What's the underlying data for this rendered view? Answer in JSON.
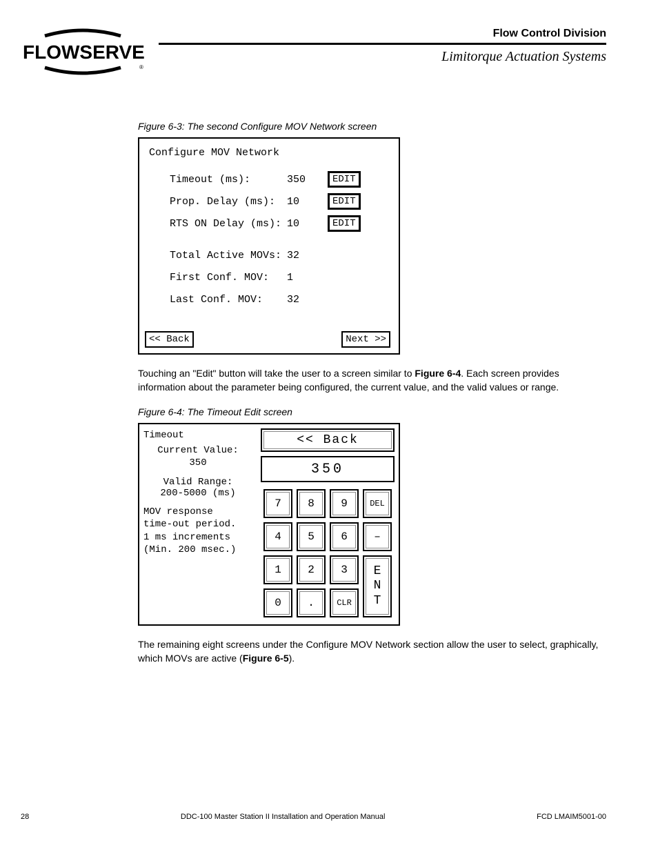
{
  "header": {
    "logo_text": "FLOWSERVE",
    "division": "Flow Control Division",
    "subtitle": "Limitorque Actuation Systems"
  },
  "fig63": {
    "caption": "Figure 6-3: The second Configure MOV Network screen",
    "title": "Configure MOV Network",
    "rows": [
      {
        "label": "Timeout (ms):",
        "value": "350",
        "edit": true
      },
      {
        "label": "Prop. Delay (ms):",
        "value": "10",
        "edit": true
      },
      {
        "label": "RTS ON Delay (ms):",
        "value": "10",
        "edit": true
      },
      {
        "label": "Total Active MOVs:",
        "value": "32",
        "edit": false
      },
      {
        "label": "First Conf. MOV:",
        "value": "1",
        "edit": false
      },
      {
        "label": "Last Conf. MOV:",
        "value": "32",
        "edit": false
      }
    ],
    "edit_label": "EDIT",
    "back": "<< Back",
    "next": "Next >>"
  },
  "para1a": "Touching an \"Edit\" button will take the user to a screen similar to ",
  "para1b": "Figure 6-4",
  "para1c": ". Each screen provides information about the parameter being configured, the current value, and the valid values or range.",
  "fig64": {
    "caption": "Figure 6-4: The Timeout Edit screen",
    "title": "Timeout",
    "cv_label": "Current Value:",
    "cv_value": "350",
    "range_label": "Valid Range:",
    "range_value": "200-5000 (ms)",
    "desc1": "MOV response",
    "desc2": "time-out period.",
    "desc3": "1 ms increments",
    "desc4": "(Min. 200 msec.)",
    "back": "<< Back",
    "display": "350",
    "keys": {
      "k7": "7",
      "k8": "8",
      "k9": "9",
      "del": "DEL",
      "k4": "4",
      "k5": "5",
      "k6": "6",
      "minus": "–",
      "k1": "1",
      "k2": "2",
      "k3": "3",
      "k0": "0",
      "dot": ".",
      "clr": "CLR",
      "ent1": "E",
      "ent2": "N",
      "ent3": "T"
    }
  },
  "para2a": "The remaining eight screens under the Configure MOV Network section allow the user to select, graphically, which MOVs are active (",
  "para2b": "Figure 6-5",
  "para2c": ").",
  "footer": {
    "page": "28",
    "center": "DDC-100 Master Station II Installation and Operation Manual",
    "right": "FCD LMAIM5001-00"
  }
}
